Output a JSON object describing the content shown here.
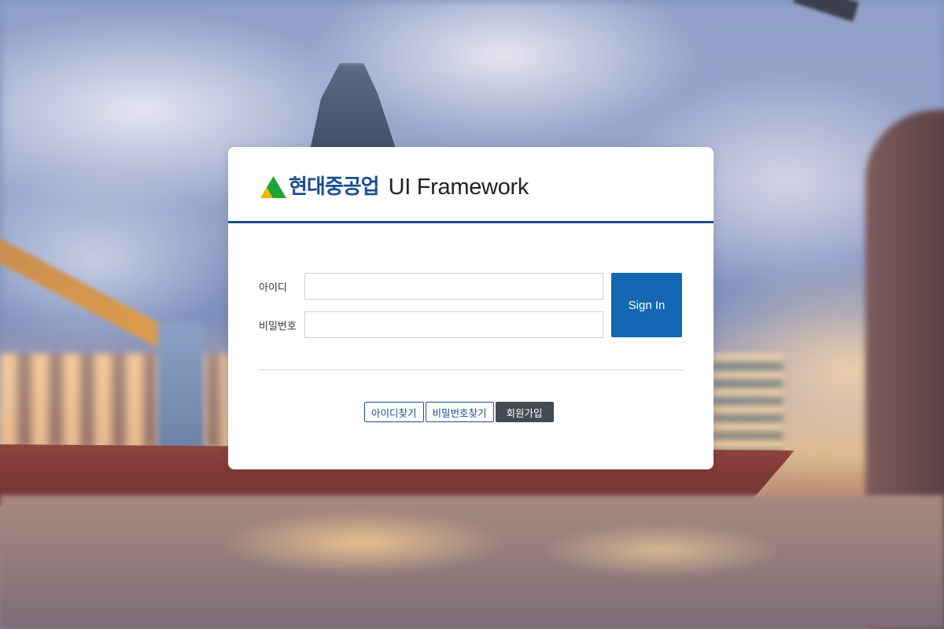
{
  "logo": {
    "company": "현대중공업",
    "product": "UI Framework"
  },
  "login": {
    "id_label": "아이디",
    "id_value": "",
    "password_label": "비밀번호",
    "password_value": "",
    "signin_label": "Sign In"
  },
  "links": {
    "find_id": "아이디찾기",
    "find_password": "비밀번호찾기",
    "signup": "회원가입"
  },
  "colors": {
    "brand_blue": "#1b4e8e",
    "signin_button": "#1467b2",
    "signup_button": "#444b52",
    "logo_green": "#1fa33c",
    "logo_yellow": "#f0b800"
  },
  "icons": {
    "logo_mark": "hyundai-triangle-logo-icon"
  }
}
